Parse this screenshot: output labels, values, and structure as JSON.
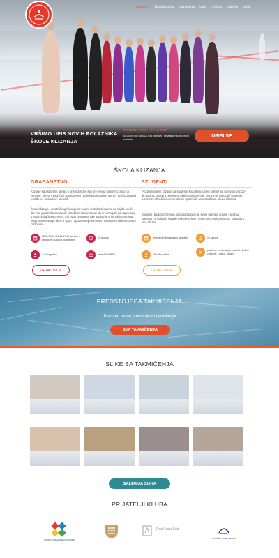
{
  "nav": {
    "items": [
      {
        "label": "Naslovna",
        "active": true
      },
      {
        "label": "Škola klizanja"
      },
      {
        "label": "Takmičenja"
      },
      {
        "label": "Upis"
      },
      {
        "label": "O klubu"
      },
      {
        "label": "Galerija"
      },
      {
        "label": "Vesti"
      }
    ]
  },
  "logo": {
    "name": "club-logo-icon"
  },
  "hero": {
    "title_line1": "VRŠIMO UPIS NOVIH POLAZNIKA",
    "title_line2": "ŠKOLE KLIZANJA",
    "term_label": "TERMINI 17.10. - 07.11.2017",
    "term_detail": "08.00-09.00 i 16.45-17.45 utorkom i četvrtkom 08.30-09.30 subotom",
    "cta_label": "UPIŠI SE"
  },
  "school": {
    "title": "ŠKOLA KLIZANJA",
    "citizens": {
      "heading": "GRAĐANSTVO",
      "para1": "Klizanje kao sport se ubraja u one sportove koji pre svega pozitivno utiču na zdravlje, razvoj motoričkih sposobnosti i poboljšanje opšteg psiho - fizičkog stanja kod dece, omladine i odraslih.",
      "para2": "Škola klizanja i umetničkog klizanja sa svojim instruktorima ima za cilj da nauči što više polaznika osnovnim klizačkim elementima i da im omogući da napreduju u svom klizačkom umeću. Cilj ovog programa nije stvaranje vrhunskih sportista nego usmeravanje dece u sport i upoznavanje sa nosim mnoštvom aktivnostima i izazovima.",
      "info": [
        {
          "icon": "calendar-icon",
          "text": "08.00-09.00 i 16.45-17.45 utorkom i četvrtkom 08.30-09.30 subotom"
        },
        {
          "icon": "clock-icon",
          "text": "10 časova"
        },
        {
          "icon": "user-icon",
          "text": "3 i više godina"
        },
        {
          "icon": "money-icon",
          "text": "cena 4.000 RSD"
        }
      ],
      "button": "DETALJNIJE"
    },
    "students": {
      "heading": "STUDENTI",
      "para1": "Program obuke klizanja za studente Fakulteta fizičke kulture se sprovodi već 10-ak godina, u okviru predmeta Aktivnosti u prirodi. Ima za cilj da obuči studente osnovnim klizačkim elementima i upozna ih sa metodikom obuke klizanja.",
      "para2": "Studenti, budući profesori, osposobljavaju da svoje učenike znanje i praksu prenesu na najbolje i stanje uslovima, kao i na ne osnovu kojih tema, situacija u svoj oblasti.",
      "info": [
        {
          "icon": "calendar-icon",
          "text": "termini će biti naknadno objavljeni"
        },
        {
          "icon": "clock-icon",
          "text": "10 časova"
        },
        {
          "icon": "user-icon",
          "text": "18 i više godina"
        },
        {
          "icon": "list-icon",
          "text": "pozitivno - nedovoljan) uradiniji - fizički i vežbanje - dobro - klizači"
        }
      ],
      "button": "DETALJNIJE"
    }
  },
  "competitions": {
    "title": "PREDSTOJEĆA TAKMIČENJA",
    "subtitle": "Trenutno nema predstojećih takmičenja",
    "button": "SVA TAKMIČENJA"
  },
  "gallery": {
    "title": "SLIKE SA TAKMIČENJA",
    "button": "GALERIJA SLIKA"
  },
  "partners": {
    "title": "PRIJATELJI KLUBA",
    "items": [
      {
        "name": "SPORT I OMLADINE VOJVODINE",
        "icon": "sport-vojvodina-logo-icon"
      },
      {
        "name": "",
        "icon": "partner-shield-logo-icon"
      },
      {
        "name": "Grad Novi Sad",
        "icon": "novi-sad-logo-icon"
      },
      {
        "name": "KLIZAČKI SAVEZ SRBIJE",
        "icon": "skating-union-logo-icon"
      }
    ]
  },
  "colors": {
    "accent": "#e0502c",
    "crimson": "#c5254b",
    "orange": "#f29a3b",
    "teal": "#2e8a93"
  }
}
